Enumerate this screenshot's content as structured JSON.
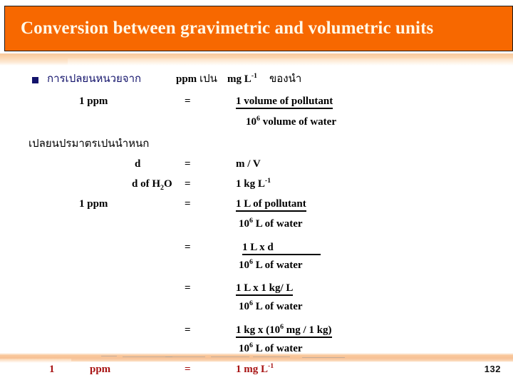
{
  "slide": {
    "title": "Conversion between gravimetric and volumetric units",
    "page_number": "132",
    "colors": {
      "header_bg": "#F76800",
      "title_text": "#FFF8E7",
      "accent_band": "#F7C094",
      "bullet_navy": "#13136B",
      "highlight_red": "#A81414",
      "body_text": "#000000"
    }
  },
  "section_one": {
    "bullet_thai": "การเปลยนหนวยจาก",
    "bullet_unit_from": "ppm",
    "bullet_thai_mid": "เปน",
    "bullet_unit_to_base": "mg L",
    "bullet_unit_to_sup": "-1",
    "bullet_thai_end": "ของนำ",
    "eq1_left": "1 ppm",
    "eq1_op": "=",
    "eq1_numerator": "1 volume of pollutant",
    "eq1_denominator_base": "10",
    "eq1_denominator_sup": "6",
    "eq1_denominator_rest": " volume of water"
  },
  "section_two": {
    "heading_thai": "เปลยนปรมาตรเปนนำหนก",
    "eq_density_left": "d",
    "eq_density_op": "=",
    "eq_density_right": "m / V",
    "eq_water_left_base": "d of H",
    "eq_water_left_sub": "2",
    "eq_water_left_rest": "O",
    "eq_water_op": "=",
    "eq_water_right_base": "1 kg L",
    "eq_water_right_sup": "-1",
    "eq_ppm_left": "1 ppm",
    "eq_ppm_op": "=",
    "eq_ppm_numerator": "1 L of pollutant",
    "eq_ppm_denominator_base": "10",
    "eq_ppm_denominator_sup": "6",
    "eq_ppm_denominator_rest": " L of water",
    "step2_op": "=",
    "step2_numerator": "1 L x d",
    "step2_denominator_base": "10",
    "step2_denominator_sup": "6",
    "step2_denominator_rest": " L of water",
    "step3_op": "=",
    "step3_numerator": "1 L x 1 kg/ L",
    "step3_denominator_base": "10",
    "step3_denominator_sup": "6",
    "step3_denominator_rest": " L of water",
    "step4_op": "=",
    "step4_numerator_a": "1 kg x (10",
    "step4_numerator_sup": "6",
    "step4_numerator_b": " mg / 1 kg)",
    "step4_denominator_base": "10",
    "step4_denominator_sup": "6",
    "step4_denominator_rest": " L of water"
  },
  "result": {
    "left_number": "1",
    "left_unit": "ppm",
    "op": "=",
    "right_base": "1 mg L",
    "right_sup": "-1"
  }
}
